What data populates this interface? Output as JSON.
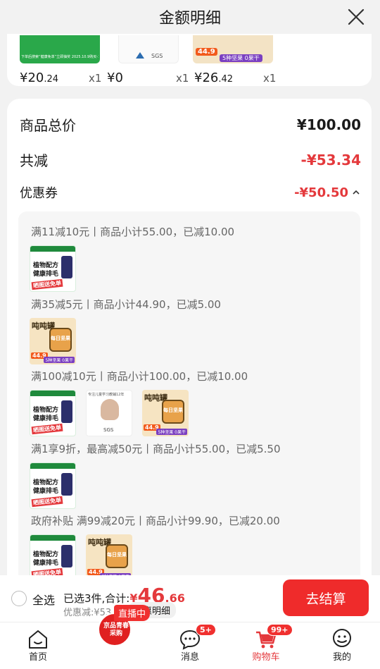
{
  "header": {
    "title": "金额明细"
  },
  "top_items": [
    {
      "price_int": "¥20",
      "price_dec": ".24",
      "qty": "x1",
      "strip_text": "下单后搜索“健康免单”立即抽奖 2025.10.9购买-11.14"
    },
    {
      "price_int": "¥0",
      "price_dec": "",
      "qty": "x1",
      "strip_text": "SGS"
    },
    {
      "price_int": "¥26",
      "price_dec": ".42",
      "qty": "x1",
      "strip_text": "5种坚果 0果干",
      "tag": "44.9"
    }
  ],
  "summary": {
    "total_label": "商品总价",
    "total_value": "¥100.00",
    "reduce_label": "共减",
    "reduce_value": "-¥53.34",
    "coupon_label": "优惠券",
    "coupon_value": "-¥50.50"
  },
  "coupon_rules": [
    {
      "text": "满11减10元丨商品小计55.00，已减10.00",
      "thumbs": [
        "herbal"
      ]
    },
    {
      "text": "满35减5元丨商品小计44.90，已减5.00",
      "thumbs": [
        "nuts"
      ]
    },
    {
      "text": "满100减10元丨商品小计100.00，已减10.00",
      "thumbs": [
        "herbal",
        "portrait",
        "nuts"
      ]
    },
    {
      "text": "满1享9折，最高减50元丨商品小计55.00，已减5.50",
      "thumbs": [
        "herbal"
      ]
    },
    {
      "text": "政府补贴 满99减20元丨商品小计99.90，已减20.00",
      "thumbs": [
        "herbal",
        "nuts"
      ]
    }
  ],
  "thumb_labels": {
    "herbal_title": "植物配方",
    "herbal_sub": "健康排毛",
    "herbal_banner": "晒图送免单",
    "nuts_title": "吨吨罐",
    "nuts_jar": "每日坚果",
    "nuts_price": "44.9",
    "nuts_banner": "5种坚果 0果干",
    "portrait_top": "专注儿童学习教辅12年",
    "portrait_bottom": "SGS"
  },
  "bottom": {
    "select_all": "全选",
    "selected_text": "已选3件,合计:",
    "total_yen": "¥",
    "total_int": "46",
    "total_dec": ".66",
    "discount_text": "优惠减:¥53.34",
    "detail_button": "优惠明细",
    "checkout": "去结算"
  },
  "tabs": [
    {
      "label": "首页",
      "icon": "home-icon"
    },
    {
      "label": "",
      "icon": "live-promo-icon",
      "badge": "直播中",
      "promo_text": "京品青春采购"
    },
    {
      "label": "消息",
      "icon": "message-icon",
      "badge": "5+"
    },
    {
      "label": "购物车",
      "icon": "cart-icon",
      "badge": "99+"
    },
    {
      "label": "我的",
      "icon": "profile-icon"
    }
  ],
  "colors": {
    "accent": "#e4393c",
    "checkout_bg": "#ef2b2b",
    "herbal_green": "#1f8a3c",
    "nuts_orange": "#e8a24a"
  }
}
